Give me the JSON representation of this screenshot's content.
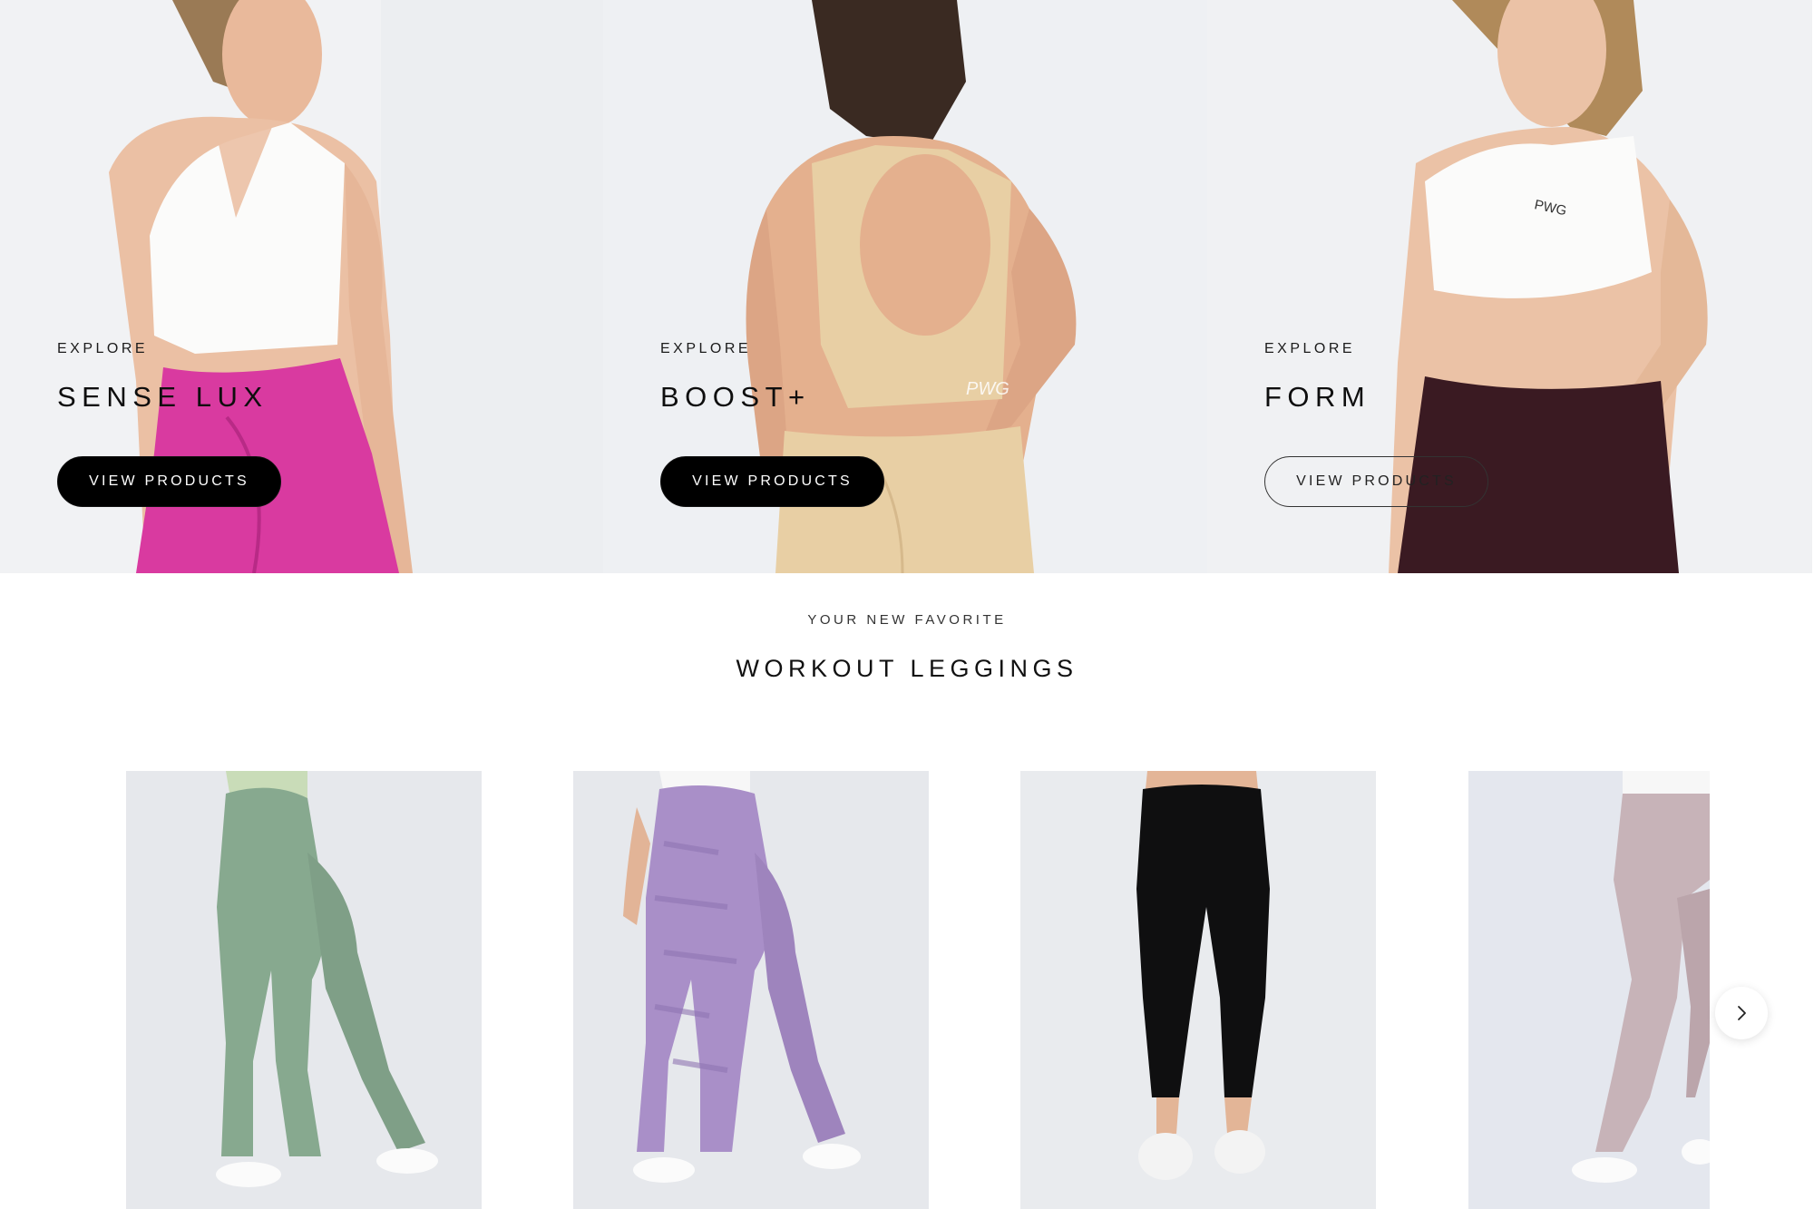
{
  "collections": [
    {
      "eyebrow": "EXPLORE",
      "title": "SENSE LUX",
      "cta_label": "VIEW PRODUCTS",
      "cta_style": "filled"
    },
    {
      "eyebrow": "EXPLORE",
      "title": "BOOST+",
      "cta_label": "VIEW PRODUCTS",
      "cta_style": "filled"
    },
    {
      "eyebrow": "EXPLORE",
      "title": "FORM",
      "cta_label": "VIEW PRODUCTS",
      "cta_style": "outline"
    }
  ],
  "featured": {
    "eyebrow": "YOUR NEW FAVORITE",
    "title": "WORKOUT LEGGINGS"
  },
  "products": [
    {
      "image": "sage-green-leggings-photo"
    },
    {
      "image": "lavender-camo-leggings-photo"
    },
    {
      "image": "black-leggings-photo"
    },
    {
      "image": "mauve-leggings-photo"
    }
  ],
  "carousel": {
    "next_icon": "chevron-right-icon"
  },
  "colors": {
    "filled_button_bg": "#000000",
    "filled_button_text": "#ffffff",
    "text_dark": "#111111",
    "hero_bg": "#eef0f3",
    "product_bg": "#e6e8ec",
    "sense_lux_leggings": "#d93aa0",
    "boost_set": "#e8cfa4",
    "form_leggings": "#3a1a22",
    "sage": "#87a98f",
    "lavender": "#a98fc8",
    "mauve": "#c7b3b8"
  }
}
